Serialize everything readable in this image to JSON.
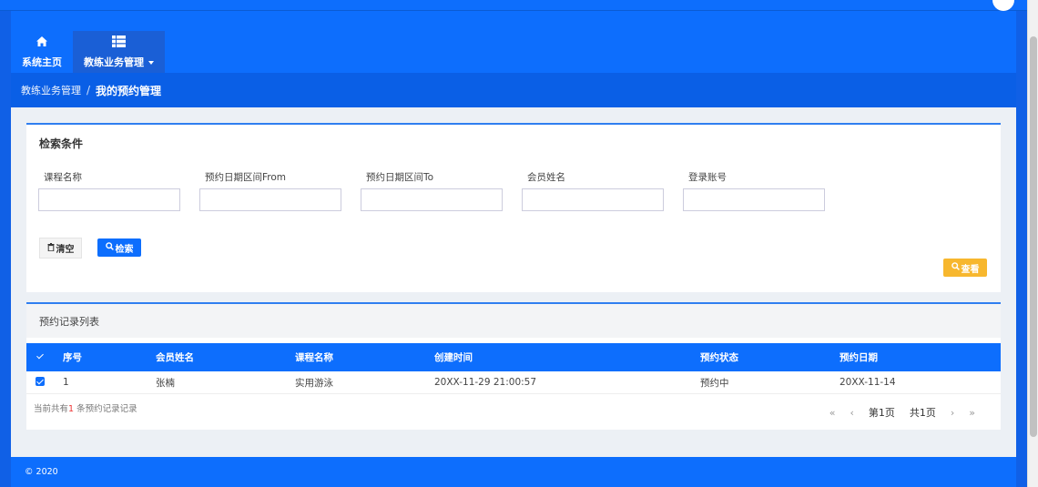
{
  "nav": {
    "home_label": "系统主页",
    "home_icon": "home-icon",
    "business_label": "教练业务管理",
    "business_icon": "list-icon"
  },
  "breadcrumb": {
    "parent": "教练业务管理",
    "separator": "/",
    "current": "我的预约管理"
  },
  "search": {
    "title": "检索条件",
    "fields": [
      {
        "label": "课程名称",
        "value": ""
      },
      {
        "label": "预约日期区间From",
        "value": ""
      },
      {
        "label": "预约日期区间To",
        "value": ""
      },
      {
        "label": "会员姓名",
        "value": ""
      },
      {
        "label": "登录账号",
        "value": ""
      }
    ],
    "clear_label": "清空",
    "search_label": "检索",
    "view_label": "查看"
  },
  "list": {
    "title": "预约记录列表",
    "columns": [
      "序号",
      "会员姓名",
      "课程名称",
      "创建时间",
      "预约状态",
      "预约日期"
    ],
    "rows": [
      {
        "no": "1",
        "member": "张楠",
        "course": "实用游泳",
        "created": "20XX-11-29 21:00:57",
        "status": "预约中",
        "date": "20XX-11-14",
        "checked": true
      }
    ],
    "summary_prefix": "当前共有",
    "summary_count": "1",
    "summary_suffix": " 条预约记录记录",
    "pager": {
      "first": "«",
      "prev": "‹",
      "page": "第1页",
      "total": "共1页",
      "next": "›",
      "last": "»"
    }
  },
  "footer": {
    "copyright": "© 2020"
  },
  "colors": {
    "primary": "#0d6efd",
    "warning": "#f7b72e",
    "accent_number": "#e33333"
  }
}
